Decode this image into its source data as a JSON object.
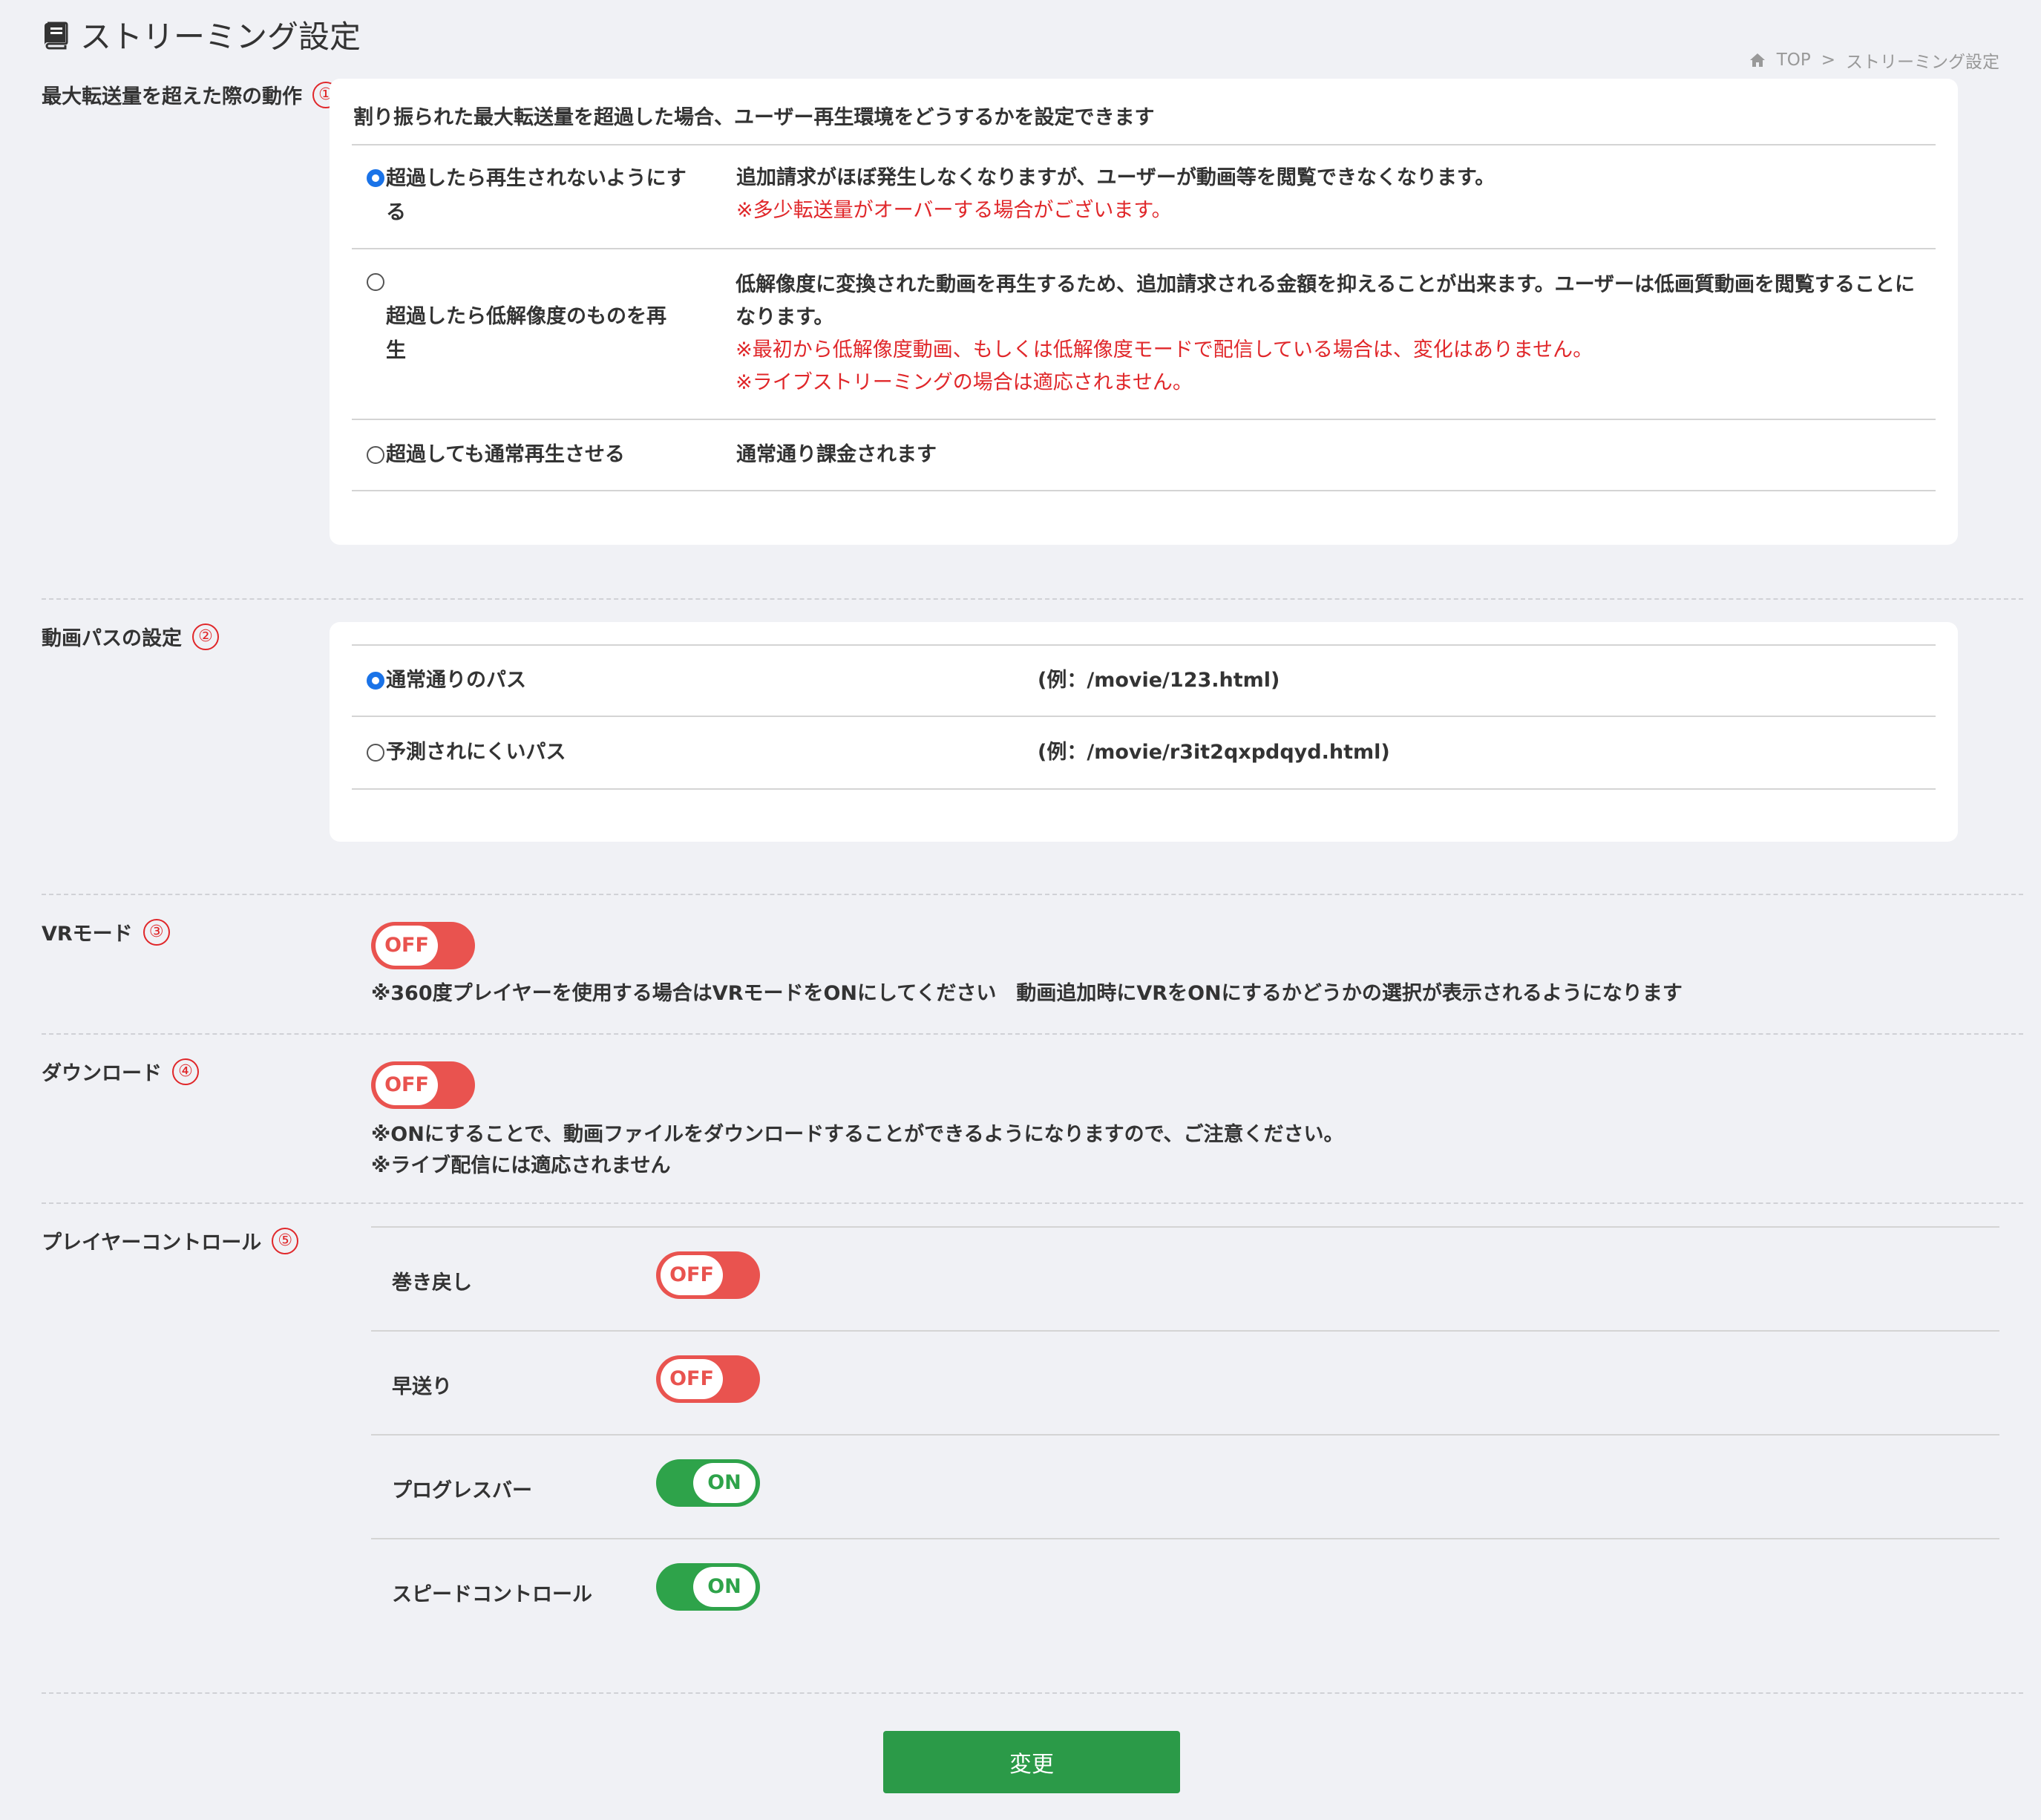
{
  "header": {
    "title": "ストリーミング設定",
    "icon": "book-icon"
  },
  "breadcrumb": {
    "home_icon": "home-icon",
    "top": "TOP",
    "sep": ">",
    "current": "ストリーミング設定"
  },
  "transfer": {
    "label": "最大転送量を超えた際の動作",
    "num": "①",
    "desc": "割り振られた最大転送量を超過した場合、ユーザー再生環境をどうするかを設定できます",
    "options": [
      {
        "label_line1": "超過したら再生されないようにす",
        "label_line2": "る",
        "checked": true,
        "main": "追加請求がほぼ発生しなくなりますが、ユーザーが動画等を閲覧できなくなります。",
        "notes": [
          "※多少転送量がオーバーする場合がございます。"
        ]
      },
      {
        "label_line1": "超過したら低解像度のものを再",
        "label_line2": "生",
        "checked": false,
        "main": "低解像度に変換された動画を再生するため、追加請求される金額を抑えることが出来ます。ユーザーは低画質動画を閲覧することになります。",
        "notes": [
          "※最初から低解像度動画、もしくは低解像度モードで配信している場合は、変化はありません。",
          "※ライブストリーミングの場合は適応されません。"
        ]
      },
      {
        "label_line1": "超過しても通常再生させる",
        "label_line2": "",
        "checked": false,
        "main": "通常通り課金されます",
        "notes": []
      }
    ]
  },
  "path": {
    "label": "動画パスの設定",
    "num": "②",
    "options": [
      {
        "label": "通常通りのパス",
        "example": "(例：/movie/123.html)",
        "checked": true
      },
      {
        "label": "予測されにくいパス",
        "example": "(例：/movie/r3it2qxpdqyd.html)",
        "checked": false
      }
    ]
  },
  "vr": {
    "label": "VRモード",
    "num": "③",
    "toggle": "OFF",
    "help": "※360度プレイヤーを使用する場合はVRモードをONにしてください　動画追加時にVRをONにするかどうかの選択が表示されるようになります"
  },
  "download": {
    "label": "ダウンロード",
    "num": "④",
    "toggle": "OFF",
    "help1": "※ONにすることで、動画ファイルをダウンロードすることができるようになりますので、ご注意ください。",
    "help2": "※ライブ配信には適応されません"
  },
  "player": {
    "label": "プレイヤーコントロール",
    "num": "⑤",
    "rows": [
      {
        "label": "巻き戻し",
        "toggle": "OFF"
      },
      {
        "label": "早送り",
        "toggle": "OFF"
      },
      {
        "label": "プログレスバー",
        "toggle": "ON"
      },
      {
        "label": "スピードコントロール",
        "toggle": "ON"
      }
    ]
  },
  "submit": "変更",
  "colors": {
    "accent_red": "#e0272a",
    "toggle_off": "#e9534f",
    "toggle_on": "#2ea34a",
    "submit_bg": "#2b9a48",
    "radio_checked": "#1a73e8"
  }
}
